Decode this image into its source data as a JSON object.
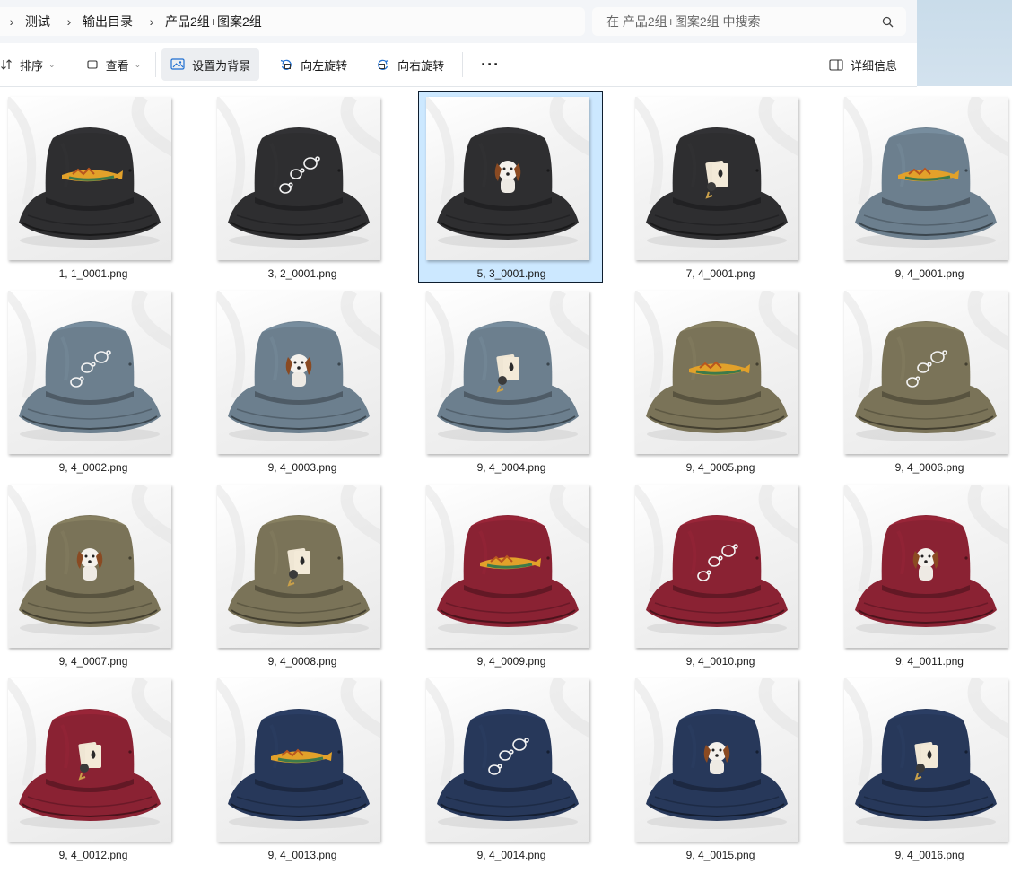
{
  "address": {
    "crumbs": [
      "测试",
      "输出目录",
      "产品2组+图案2组"
    ]
  },
  "search": {
    "placeholder": "在 产品2组+图案2组 中搜索"
  },
  "toolbar": {
    "sort": "排序",
    "view": "查看",
    "set_background": "设置为背景",
    "rotate_left": "向左旋转",
    "rotate_right": "向右旋转",
    "more": "···",
    "details": "详细信息"
  },
  "colors": {
    "black": "#2e2e30",
    "gray_blue": "#6c7f8e",
    "olive": "#7a7358",
    "burgundy": "#8a2233",
    "navy": "#27385a",
    "selection": "#cce8ff"
  },
  "files": [
    {
      "name": "1, 1_0001.png",
      "hat": "black",
      "design": "fish"
    },
    {
      "name": "3, 2_0001.png",
      "hat": "black",
      "design": "turtles"
    },
    {
      "name": "5, 3_0001.png",
      "hat": "black",
      "design": "dog",
      "selected": true
    },
    {
      "name": "7, 4_0001.png",
      "hat": "black",
      "design": "cards"
    },
    {
      "name": "9, 4_0001.png",
      "hat": "gray_blue",
      "design": "fish"
    },
    {
      "name": "9, 4_0002.png",
      "hat": "gray_blue",
      "design": "turtles"
    },
    {
      "name": "9, 4_0003.png",
      "hat": "gray_blue",
      "design": "dog"
    },
    {
      "name": "9, 4_0004.png",
      "hat": "gray_blue",
      "design": "cards"
    },
    {
      "name": "9, 4_0005.png",
      "hat": "olive",
      "design": "fish"
    },
    {
      "name": "9, 4_0006.png",
      "hat": "olive",
      "design": "turtles"
    },
    {
      "name": "9, 4_0007.png",
      "hat": "olive",
      "design": "dog"
    },
    {
      "name": "9, 4_0008.png",
      "hat": "olive",
      "design": "cards"
    },
    {
      "name": "9, 4_0009.png",
      "hat": "burgundy",
      "design": "fish"
    },
    {
      "name": "9, 4_0010.png",
      "hat": "burgundy",
      "design": "turtles"
    },
    {
      "name": "9, 4_0011.png",
      "hat": "burgundy",
      "design": "dog"
    },
    {
      "name": "9, 4_0012.png",
      "hat": "burgundy",
      "design": "cards"
    },
    {
      "name": "9, 4_0013.png",
      "hat": "navy",
      "design": "fish"
    },
    {
      "name": "9, 4_0014.png",
      "hat": "navy",
      "design": "turtles"
    },
    {
      "name": "9, 4_0015.png",
      "hat": "navy",
      "design": "dog"
    },
    {
      "name": "9, 4_0016.png",
      "hat": "navy",
      "design": "cards"
    }
  ]
}
